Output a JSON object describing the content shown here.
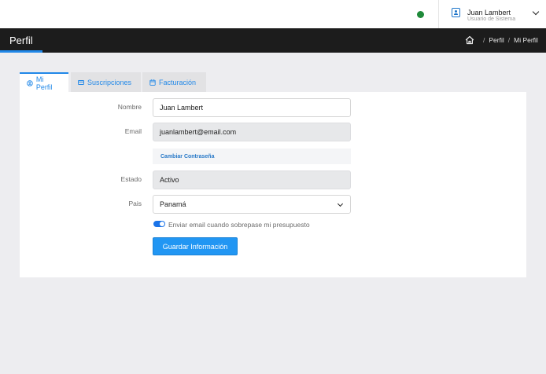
{
  "topbar": {
    "user_name": "Juan Lambert",
    "user_role": "Usuario de Sistema",
    "status_color": "#1f8a3a"
  },
  "header": {
    "title": "Perfil",
    "breadcrumb": [
      "Perfil",
      "Mi Perfil"
    ]
  },
  "tabs": [
    {
      "label": "Mi Perfil",
      "icon": "user-circle-icon",
      "active": true
    },
    {
      "label": "Suscripciones",
      "icon": "card-icon",
      "active": false
    },
    {
      "label": "Facturación",
      "icon": "calendar-icon",
      "active": false
    }
  ],
  "form": {
    "nombre_label": "Nombre",
    "nombre_value": "Juan Lambert",
    "email_label": "Email",
    "email_value": "juanlambert@email.com",
    "change_password": "Cambiar Contraseña",
    "estado_label": "Estado",
    "estado_value": "Activo",
    "pais_label": "Pais",
    "pais_value": "Panamá",
    "notify_label": "Enviar email cuando sobrepase mi presupuesto",
    "notify_enabled": true,
    "save_label": "Guardar Información"
  },
  "colors": {
    "accent": "#2188e8",
    "header_bg": "#1c1c1c",
    "button_bg": "#2196f3"
  }
}
